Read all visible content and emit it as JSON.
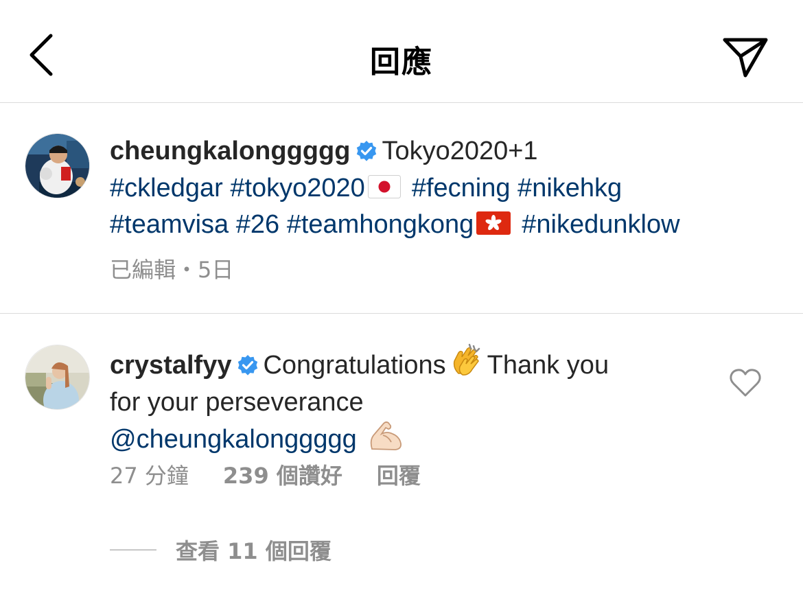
{
  "header": {
    "title": "回應",
    "back_icon": "chevron-left-icon",
    "share_icon": "paper-plane-icon"
  },
  "caption": {
    "username": "cheungkalonggggg",
    "verified": true,
    "text": "Tokyo2020+1",
    "tags_line1_a": "#ckledgar #tokyo2020",
    "flag1": "japan-flag",
    "tags_line1_b": "#fecning #nikehkg",
    "tags_line2_a": "#teamvisa #26 #teamhongkong",
    "flag2": "hong-kong-flag",
    "tags_line2_b": "#nikedunklow",
    "meta": "已編輯・5日"
  },
  "comment": {
    "username": "crystalfyy",
    "verified": true,
    "text_a": "Congratulations",
    "emoji1": "clapping-hands-emoji",
    "text_b": "Thank you",
    "text_c": "for your perseverance",
    "mention": "@cheungkalonggggg",
    "emoji2": "flexed-biceps-emoji",
    "time": "27 分鐘",
    "likes": "239 個讚好",
    "reply_label": "回覆",
    "view_replies": "查看 11 個回覆"
  },
  "colors": {
    "link": "#00376b",
    "verified": "#3897f0",
    "meta": "#8e8e8e",
    "divider": "#dbdbdb"
  }
}
